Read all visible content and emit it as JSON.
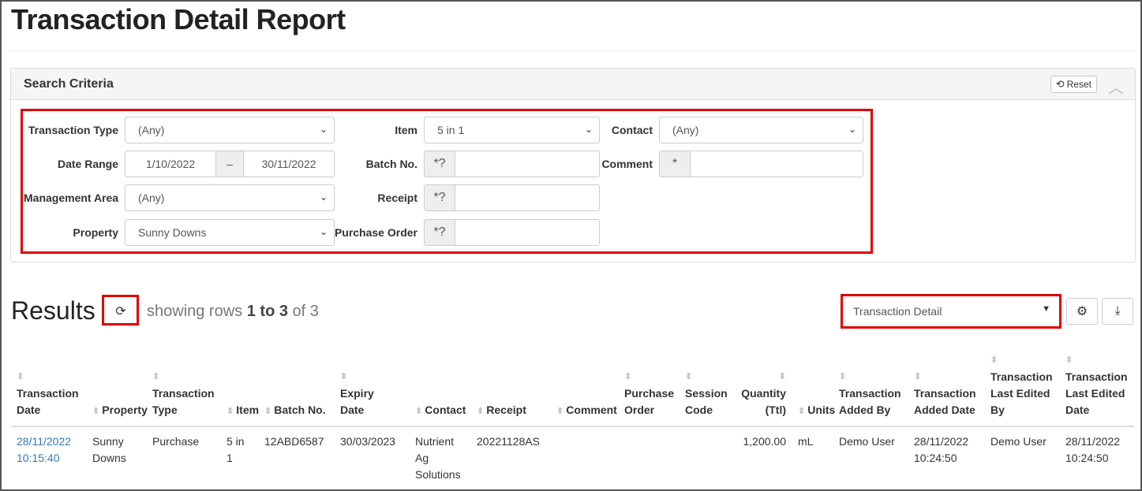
{
  "page": {
    "title": "Transaction Detail Report"
  },
  "search_criteria": {
    "title": "Search Criteria",
    "reset_label": "Reset",
    "transaction_type": {
      "label": "Transaction Type",
      "value": "(Any)"
    },
    "date_range": {
      "label": "Date Range",
      "from": "1/10/2022",
      "separator": "–",
      "to": "30/11/2022"
    },
    "management_area": {
      "label": "Management Area",
      "value": "(Any)"
    },
    "property": {
      "label": "Property",
      "value": "Sunny Downs"
    },
    "item": {
      "label": "Item",
      "value": "5 in 1"
    },
    "batch_no": {
      "label": "Batch No.",
      "addon": "*?",
      "value": ""
    },
    "receipt": {
      "label": "Receipt",
      "addon": "*?",
      "value": ""
    },
    "purchase_order": {
      "label": "Purchase Order",
      "addon": "*?",
      "value": ""
    },
    "contact": {
      "label": "Contact",
      "value": "(Any)"
    },
    "comment": {
      "label": "Comment",
      "addon": "*",
      "value": ""
    }
  },
  "results": {
    "title": "Results",
    "showing_prefix": "showing rows",
    "range": "1 to 3",
    "of_word": "of",
    "total": "3",
    "view": "Transaction Detail"
  },
  "table": {
    "columns": [
      [
        "Transaction",
        "Date"
      ],
      [
        "Property"
      ],
      [
        "Transaction",
        "Type"
      ],
      [
        "Item"
      ],
      [
        "Batch No."
      ],
      [
        "Expiry",
        "Date"
      ],
      [
        "Contact"
      ],
      [
        "Receipt"
      ],
      [
        "Comment"
      ],
      [
        "Purchase",
        "Order"
      ],
      [
        "Session",
        "Code"
      ],
      [
        "Quantity",
        "(Ttl)"
      ],
      [
        "Units"
      ],
      [
        "Transaction",
        "Added By"
      ],
      [
        "Transaction",
        "Added Date"
      ],
      [
        "Transaction",
        "Last Edited",
        "By"
      ],
      [
        "Transaction",
        "Last Edited",
        "Date"
      ]
    ],
    "rows": [
      {
        "date": [
          "28/11/2022",
          "10:15:40"
        ],
        "property": [
          "Sunny",
          "Downs"
        ],
        "type": [
          "Purchase"
        ],
        "item": [
          "5 in",
          "1"
        ],
        "batch": [
          "12ABD6587"
        ],
        "expiry": [
          "30/03/2023"
        ],
        "contact": [
          "Nutrient",
          "Ag",
          "Solutions"
        ],
        "receipt": [
          "20221128AS"
        ],
        "comment": [],
        "purchase_order": [],
        "session_code": [],
        "quantity": [
          "1,200.00"
        ],
        "units": [
          "mL"
        ],
        "added_by": [
          "Demo User"
        ],
        "added_date": [
          "28/11/2022",
          "10:24:50"
        ],
        "edited_by": [
          "Demo User"
        ],
        "edited_date": [
          "28/11/2022",
          "10:24:50"
        ]
      }
    ]
  },
  "colors": {
    "highlight": "#e00000",
    "link": "#337ab7",
    "addon_bg": "#eeeeee"
  }
}
